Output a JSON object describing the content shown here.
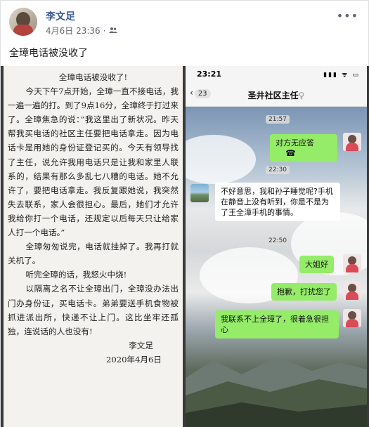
{
  "post": {
    "author": "李文足",
    "timestamp": "4月6日 23:36",
    "separator": "·",
    "audience_icon": "friends-icon",
    "more_label": "•••",
    "text": "全璋电话被没收了"
  },
  "letter": {
    "title": "全璋电话被没收了!",
    "paragraphs": [
      "今天下午7点开始，全璋一直不接电话，我一遍一遍的打。到了9点16分，全璋终于打过来了。全璋焦急的说：”我这里出了新状况。昨天帮我买电话的社区主任要把电话拿走。因为电话卡是用她的身份证登记买的。今天有领导找了主任，说允许我用电话只是让我和家里人联系的，结果有那么多乱七八糟的电话。她不允许了，要把电话拿走。我反复跟她说，我突然失去联系，家人会很担心。最后，她们才允许我给你打一个电话，还规定以后每天只让给家人打一个电话。”",
      "全璋匆匆说完，电话就挂掉了。我再打就关机了。",
      "听完全璋的话，我怒火中烧!",
      "以隔离之名不让全璋出门，全璋没办法出门办身份证，买电话卡。弟弟要送手机食物被抓进派出所，快递不让上门。这比坐牢还孤独，连说话的人也没有!"
    ],
    "signature": "李文足",
    "date": "2020年4月6日"
  },
  "chat": {
    "status_time": "23:21",
    "status_icons": "▮▮▮ ᯤ ▭",
    "back_symbol": "‹",
    "unread_count": "23",
    "title": "圣井社区主任",
    "title_suffix": "♀",
    "messages": [
      {
        "time": "21:57"
      },
      {
        "side": "right",
        "text": "对方无应答",
        "icon": "phone-hangup-icon"
      },
      {
        "time": "22:30"
      },
      {
        "side": "left",
        "text": "不好意思，我和孙子睡觉呢?手机在静音上没有听到，你是不是为了王全漳手机的事情。"
      },
      {
        "time": "22:50"
      },
      {
        "side": "right",
        "text": "大姐好"
      },
      {
        "side": "right",
        "text": "抱歉，打扰您了"
      },
      {
        "side": "right",
        "text": "我联系不上全璋了，很着急很担心"
      }
    ]
  },
  "colors": {
    "link": "#385898",
    "wechat_green": "#95ec69"
  }
}
